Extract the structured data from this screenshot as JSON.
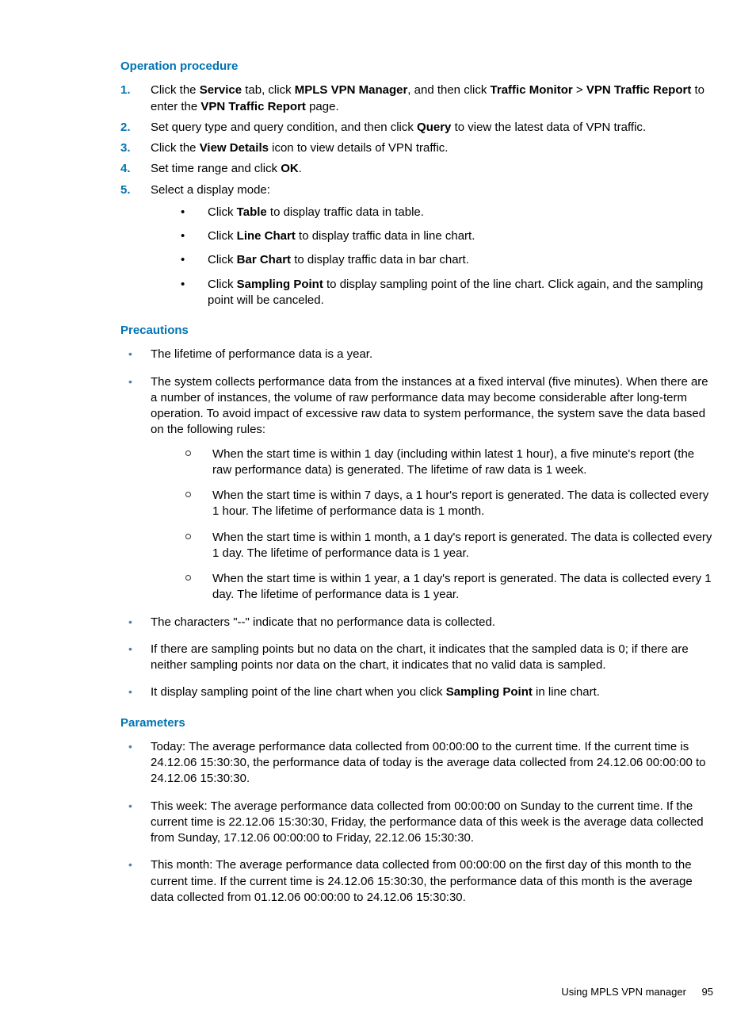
{
  "headings": {
    "op": "Operation procedure",
    "prec": "Precautions",
    "params": "Parameters"
  },
  "steps": {
    "s1a": "Click the ",
    "s1b": "Service",
    "s1c": " tab, click ",
    "s1d": "MPLS VPN Manager",
    "s1e": ", and then click ",
    "s1f": "Traffic Monitor",
    "s1g": " > ",
    "s1h": "VPN Traffic Report",
    "s1i": " to enter the ",
    "s1j": "VPN Traffic Report",
    "s1k": " page.",
    "s2a": "Set query type and query condition, and then click ",
    "s2b": "Query",
    "s2c": " to view the latest data of VPN traffic.",
    "s3a": "Click the ",
    "s3b": "View Details",
    "s3c": " icon to view details of VPN traffic.",
    "s4a": "Set time range and click ",
    "s4b": "OK",
    "s4c": ".",
    "s5": "Select a display mode:"
  },
  "modes": {
    "m1a": "Click ",
    "m1b": "Table",
    "m1c": " to display traffic data in table.",
    "m2a": "Click ",
    "m2b": "Line Chart",
    "m2c": " to display traffic data in line chart.",
    "m3a": "Click ",
    "m3b": "Bar Chart",
    "m3c": " to display traffic data in bar chart.",
    "m4a": "Click ",
    "m4b": "Sampling Point",
    "m4c": " to display sampling point of the line chart. Click again, and the sampling point will be canceled."
  },
  "prec": {
    "p1": "The lifetime of performance data is a year.",
    "p2": "The system collects performance data from the instances at a fixed interval (five minutes). When there are a number of instances, the volume of raw performance data may become considerable after long-term operation. To avoid impact of excessive raw data to system performance, the system save the data based on the following rules:",
    "p2s1": "When the start time is within 1 day (including within latest 1 hour), a five minute's report (the raw performance data) is generated. The lifetime of raw data is 1 week.",
    "p2s2": "When the start time is within 7 days, a 1 hour's report is generated. The data is collected every 1 hour. The lifetime of performance data is 1 month.",
    "p2s3": "When the start time is within 1 month, a 1 day's report is generated. The data is collected every 1 day. The lifetime of performance data is 1 year.",
    "p2s4": "When the start time is within 1 year, a 1 day's report is generated. The data is collected every 1 day. The lifetime of performance data is 1 year.",
    "p3": "The characters \"--\" indicate that no performance data is collected.",
    "p4": "If there are sampling points but no data on the chart, it indicates that the sampled data is 0; if there are neither sampling points nor data on the chart, it indicates that no valid data is sampled.",
    "p5a": "It display sampling point of the line chart when you click ",
    "p5b": "Sampling Point",
    "p5c": " in line chart."
  },
  "params": {
    "pa1": "Today: The average performance data collected from 00:00:00 to the current time. If the current time is 24.12.06 15:30:30, the performance data of today is the average data collected from 24.12.06 00:00:00 to 24.12.06 15:30:30.",
    "pa2": "This week: The average performance data collected from 00:00:00 on Sunday to the current time. If the current time is 22.12.06 15:30:30, Friday, the performance data of this week is the average data collected from Sunday, 17.12.06 00:00:00 to Friday, 22.12.06 15:30:30.",
    "pa3": "This month: The average performance data collected from 00:00:00 on the first day of this month to the current time. If the current time is 24.12.06 15:30:30, the performance data of this month is the average data collected from 01.12.06 00:00:00 to 24.12.06 15:30:30."
  },
  "footer": {
    "text": "Using MPLS VPN manager",
    "page": "95"
  },
  "nums": {
    "n1": "1.",
    "n2": "2.",
    "n3": "3.",
    "n4": "4.",
    "n5": "5."
  }
}
